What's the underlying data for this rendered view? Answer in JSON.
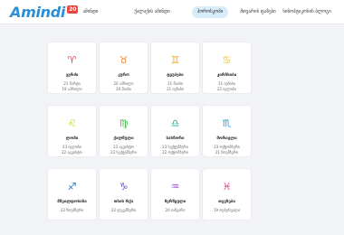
{
  "logo": {
    "text": "Amindi",
    "badge": "20"
  },
  "nav": [
    {
      "label": "ამინდი",
      "active": false
    },
    {
      "label": "ქალაქის ამინდი",
      "active": false
    },
    {
      "label": "ჰოროსკოპი",
      "active": true
    },
    {
      "label": "მთვარის ფაზები",
      "active": false
    },
    {
      "label": "სინოპტიკოსის ბლოგი",
      "active": false
    }
  ],
  "signs": [
    {
      "name": "ვერძი",
      "date1": "21 მარტი",
      "date2": "19 აპრილი",
      "glyph": "♈",
      "color": "#f0423c"
    },
    {
      "name": "კურო",
      "date1": "20 აპრილი",
      "date2": "20 მაისი",
      "glyph": "♉",
      "color": "#f0801e"
    },
    {
      "name": "ტყუპები",
      "date1": "21 მაისი",
      "date2": "21 ივნისი",
      "glyph": "♊",
      "color": "#f7a21b"
    },
    {
      "name": "კირჩხიბი",
      "date1": "21 ივნისი",
      "date2": "22 ივლისი",
      "glyph": "♋",
      "color": "#f5c20e"
    },
    {
      "name": "ლომი",
      "date1": "23 ივლისი",
      "date2": "22 აგვისტო",
      "glyph": "♌",
      "color": "#c3d11a"
    },
    {
      "name": "ქალწული",
      "date1": "23 აგვისტო",
      "date2": "22 სექტემბერი",
      "glyph": "♍",
      "color": "#45b649"
    },
    {
      "name": "სასწორი",
      "date1": "23 სექტემბერი",
      "date2": "22 ოქტომბერი",
      "glyph": "♎",
      "color": "#24a99a"
    },
    {
      "name": "მორიელი",
      "date1": "23 ოქტომბერი",
      "date2": "21 ნოემბერი",
      "glyph": "♏",
      "color": "#1f9ad6"
    },
    {
      "name": "მშვილდოსანი",
      "date1": "22 ნოემბერი",
      "date2": "",
      "glyph": "♐",
      "color": "#2d74d1"
    },
    {
      "name": "თხის რქა",
      "date1": "22 დეკემბერი",
      "date2": "",
      "glyph": "♑",
      "color": "#6a4cc4"
    },
    {
      "name": "მერწყული",
      "date1": "20 იანვარი",
      "date2": "",
      "glyph": "♒",
      "color": "#9646c0"
    },
    {
      "name": "თევზები",
      "date1": "19 თებერვალი",
      "date2": "",
      "glyph": "♓",
      "color": "#d63e8c"
    }
  ]
}
